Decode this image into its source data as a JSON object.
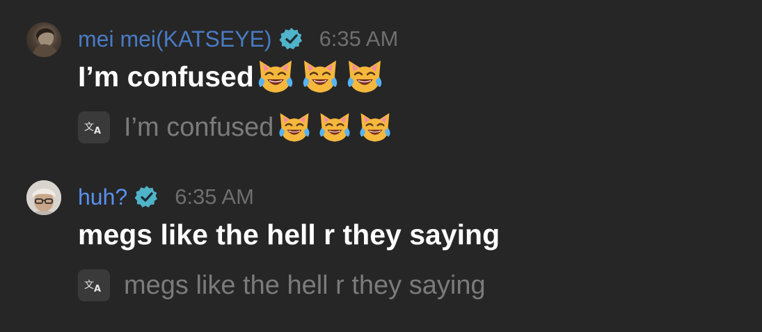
{
  "messages": [
    {
      "username": "mei mei(KATSEYE)",
      "verified": true,
      "timestamp": "6:35 AM",
      "text": "I’m confused",
      "emojis": [
        "cat-tears-of-joy",
        "cat-tears-of-joy",
        "cat-tears-of-joy"
      ],
      "translation": "I’m confused"
    },
    {
      "username": "huh?",
      "verified": true,
      "timestamp": "6:35 AM",
      "text": "megs like the hell r they saying",
      "emojis": [],
      "translation": "megs like the hell r they saying"
    }
  ],
  "colors": {
    "background": "#262626",
    "username_1": "#4a7bc4",
    "username_2": "#5a91f0",
    "verified_badge": "#4fb3c9",
    "timestamp": "#6f6f6f",
    "translation_text": "#7b7b7b"
  },
  "icons": {
    "verified": "verified-badge-icon",
    "translate": "translate-icon",
    "emoji": "cat-with-tears-of-joy-emoji"
  }
}
